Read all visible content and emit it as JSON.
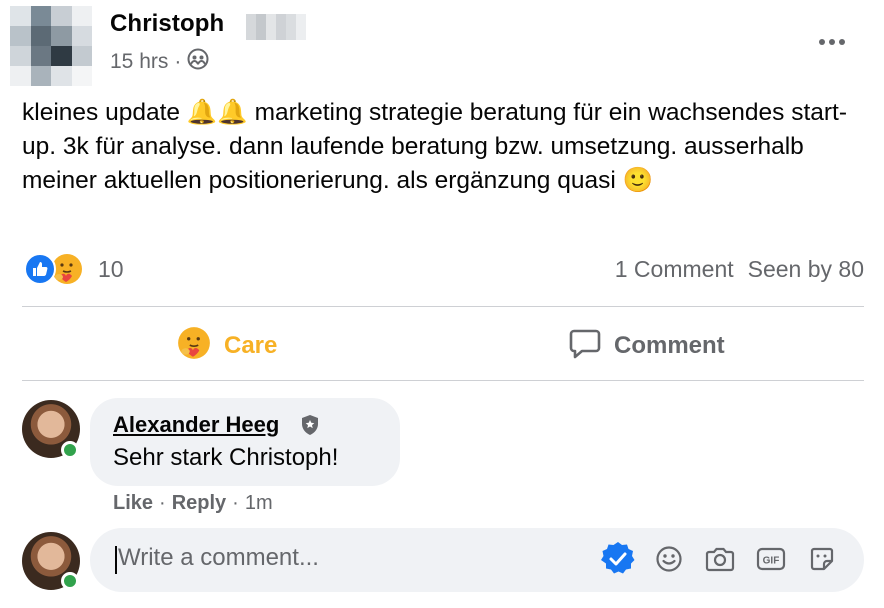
{
  "post": {
    "author": "Christoph",
    "time": "15 hrs",
    "separator": "·",
    "text": "kleines update 🔔🔔 marketing strategie beratung für ein wachsendes start-up. 3k für analyse. dann laufende beratung bzw. umsetzung. ausserhalb meiner aktuellen positionerierung. als ergänzung quasi 🙂",
    "audience_icon": "friends-icon"
  },
  "reactions": {
    "count": "10",
    "types": [
      "like-icon",
      "care-icon"
    ],
    "comments_count": "1 Comment",
    "seen_by": "Seen by 80"
  },
  "actions": {
    "care_label": "Care",
    "comment_label": "Comment"
  },
  "comment": {
    "author": "Alexander Heeg",
    "text": "Sehr stark Christoph!",
    "like_label": "Like",
    "reply_label": "Reply",
    "time": "1m",
    "dot": "·"
  },
  "composer": {
    "placeholder": "Write a comment...",
    "icons": [
      "checkmark-icon",
      "emoji-icon",
      "camera-icon",
      "gif-icon",
      "sticker-icon"
    ]
  },
  "colors": {
    "like_blue": "#1877f2",
    "care_yellow": "#f7b125",
    "secondary_text": "#65676b",
    "bubble_bg": "#f0f2f5",
    "online_green": "#31a24c"
  }
}
